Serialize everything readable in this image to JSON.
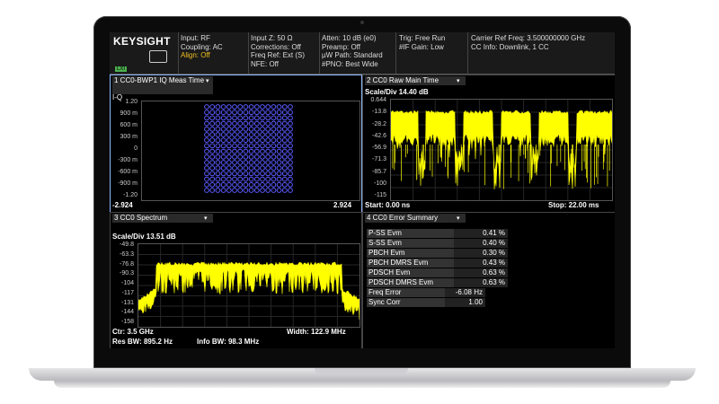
{
  "status": {
    "brand": "KEYSIGHT",
    "lxi": "LXI",
    "col1": [
      "Input: RF",
      "Coupling: AC",
      "Align: Off"
    ],
    "col2": [
      "Input Z: 50 Ω",
      "Corrections: Off",
      "Freq Ref: Ext (S)",
      "NFE: Off"
    ],
    "col3": [
      "Atten: 10 dB (e0)",
      "Preamp: Off",
      "µW Path: Standard",
      "#PNO: Best Wide"
    ],
    "col4": [
      "Trig: Free Run",
      "#IF Gain: Low"
    ],
    "col5": [
      "Carrier Ref Freq: 3.500000000 GHz",
      "CC Info: Downlink, 1 CC"
    ]
  },
  "w1": {
    "title": "1 CC0-BWP1 IQ Meas Time",
    "axis": "I-Q",
    "yticks": [
      "1.20",
      "900 m",
      "600 m",
      "300 m",
      "0",
      "-300 m",
      "-600 m",
      "-900 m",
      "-1.20"
    ],
    "xmin": "-2.924",
    "xmax": "2.924",
    "constellation": {
      "grid": 16,
      "marker": "circle",
      "color": "#5a5aff"
    }
  },
  "w2": {
    "title": "2 CC0 Raw Main Time",
    "scale": "Scale/Div 14.40 dB",
    "yticks": [
      "0.644",
      "-13.8",
      "-28.2",
      "-42.6",
      "-56.9",
      "-71.3",
      "-85.7",
      "-100",
      "-115"
    ],
    "start": "Start: 0.00 ns",
    "stop": "Stop: 22.00 ms",
    "trace_color": "#ffff00"
  },
  "w3": {
    "title": "3 CC0 Spectrum",
    "scale": "Scale/Div 13.51 dB",
    "yticks": [
      "-49.8",
      "-63.3",
      "-76.8",
      "-90.3",
      "-104",
      "-117",
      "-131",
      "-144",
      "-158"
    ],
    "ctr": "Ctr: 3.5 GHz",
    "width": "Width: 122.9 MHz",
    "resbw": "Res BW: 895.2 Hz",
    "infobw": "Info BW: 98.3 MHz",
    "trace_color": "#ffff00"
  },
  "w4": {
    "title": "4 CC0 Error Summary",
    "rows": [
      {
        "label": "P-SS Evm",
        "value": "0.41 %"
      },
      {
        "label": "S-SS Evm",
        "value": "0.40 %"
      },
      {
        "label": "PBCH Evm",
        "value": "0.30 %"
      },
      {
        "label": "PBCH DMRS Evm",
        "value": "0.43 %"
      },
      {
        "label": "PDSCH Evm",
        "value": "0.63 %"
      },
      {
        "label": "PDSCH DMRS Evm",
        "value": "0.63 %"
      },
      {
        "label": "Freq Error",
        "value": "-6.08 Hz"
      },
      {
        "label": "Sync Corr",
        "value": "1.00"
      }
    ]
  },
  "dropdown_icon": "▾"
}
